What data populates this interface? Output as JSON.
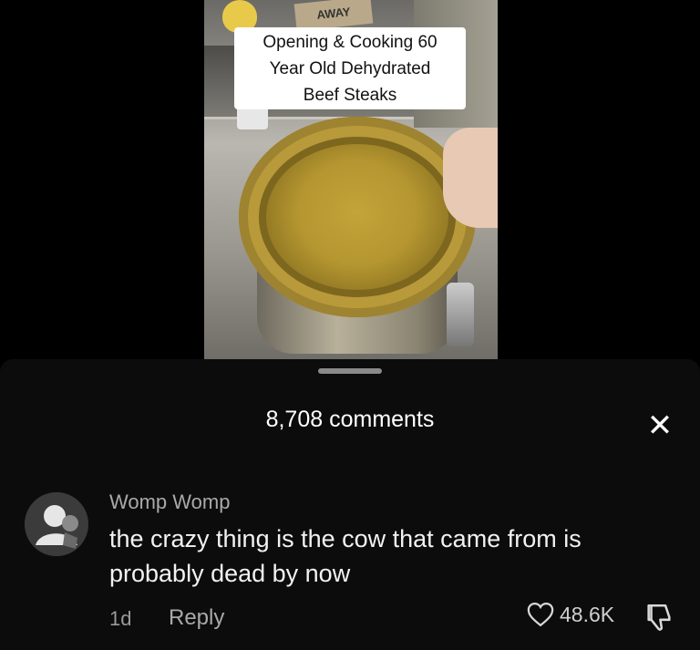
{
  "video": {
    "caption": "Opening & Cooking 60\nYear Old Dehydrated\nBeef Steaks",
    "box_label": "AWAY"
  },
  "comments_sheet": {
    "count_label": "8,708 comments",
    "close_icon": "close-icon"
  },
  "comment": {
    "username": "Womp Womp",
    "text": "the crazy thing is the cow that came from is probably dead by now",
    "time": "1d",
    "reply_label": "Reply",
    "likes": "48.6K"
  },
  "colors": {
    "background": "#000000",
    "sheet": "#0c0c0c",
    "text_primary": "#f2f2f2",
    "text_secondary": "#a9a9a9"
  }
}
